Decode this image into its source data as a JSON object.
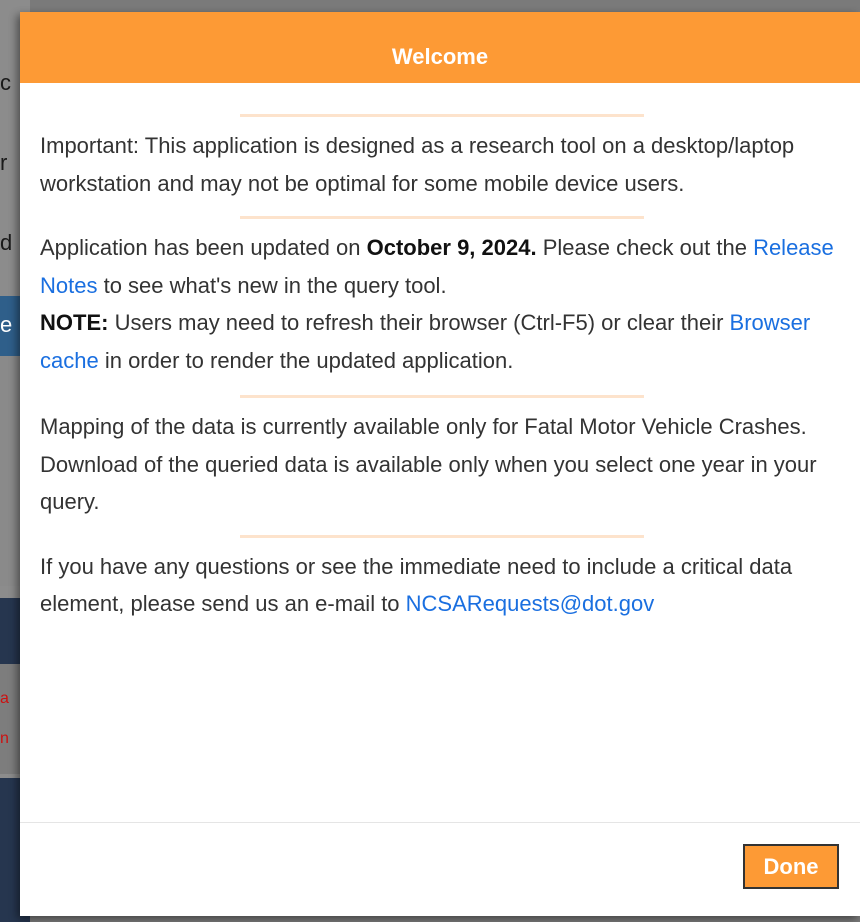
{
  "background": {
    "partial_letters": [
      "c",
      "r",
      "d",
      "e",
      "a",
      "n"
    ]
  },
  "modal": {
    "title": "Welcome",
    "paragraph1": "Important: This application is designed as a research tool on a desktop/laptop workstation and may not be optimal for some mobile device users.",
    "paragraph2": {
      "text1": "Application has been updated on ",
      "date": "October 9, 2024.",
      "text2": " Please check out the ",
      "release_notes_link": "Release Notes",
      "text3": " to see what's new in the query tool.",
      "note_label": "NOTE:",
      "text4": " Users may need to refresh their browser (Ctrl-F5) or clear their ",
      "browser_cache_link": "Browser cache",
      "text5": " in order to render the updated application."
    },
    "paragraph3": {
      "line1": "Mapping of the data is currently available only for Fatal Motor Vehicle Crashes.",
      "line2": "Download of the queried data is available only when you select one year in your query."
    },
    "paragraph4": {
      "text": "If you have any questions or see the immediate need to include a critical data element, please send us an e-mail to ",
      "email_link": "NCSARequests@dot.gov"
    },
    "done_label": "Done"
  },
  "colors": {
    "header": "#fd9a35",
    "link": "#1a6fe0",
    "divider": "#fde3cc"
  }
}
